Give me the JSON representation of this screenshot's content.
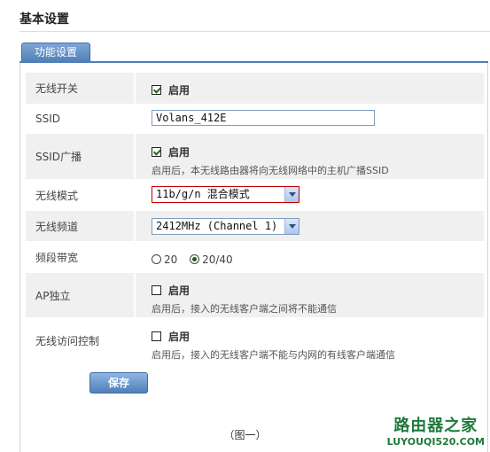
{
  "page": {
    "title": "基本设置"
  },
  "tab": {
    "label": "功能设置"
  },
  "rows": {
    "wireless_switch": {
      "label": "无线开关",
      "checked": true,
      "option": "启用"
    },
    "ssid": {
      "label": "SSID",
      "value": "Volans_412E"
    },
    "ssid_broadcast": {
      "label": "SSID广播",
      "checked": true,
      "option": "启用",
      "hint": "启用后，本无线路由器将向无线网络中的主机广播SSID"
    },
    "wireless_mode": {
      "label": "无线模式",
      "value": "11b/g/n 混合模式"
    },
    "wireless_channel": {
      "label": "无线频道",
      "value": "2412MHz (Channel 1)"
    },
    "bandwidth": {
      "label": "频段带宽",
      "options": [
        "20",
        "20/40"
      ],
      "selected": "20/40"
    },
    "ap_isolation": {
      "label": "AP独立",
      "checked": false,
      "option": "启用",
      "hint": "启用后，接入的无线客户端之间将不能通信"
    },
    "access_control": {
      "label": "无线访问控制",
      "checked": false,
      "option": "启用",
      "hint": "启用后，接入的无线客户端不能与内网的有线客户端通信"
    }
  },
  "save_label": "保存",
  "caption": "（图一）",
  "watermark": {
    "line1": "路由器之家",
    "line2": "LUYOUQI520.COM"
  }
}
